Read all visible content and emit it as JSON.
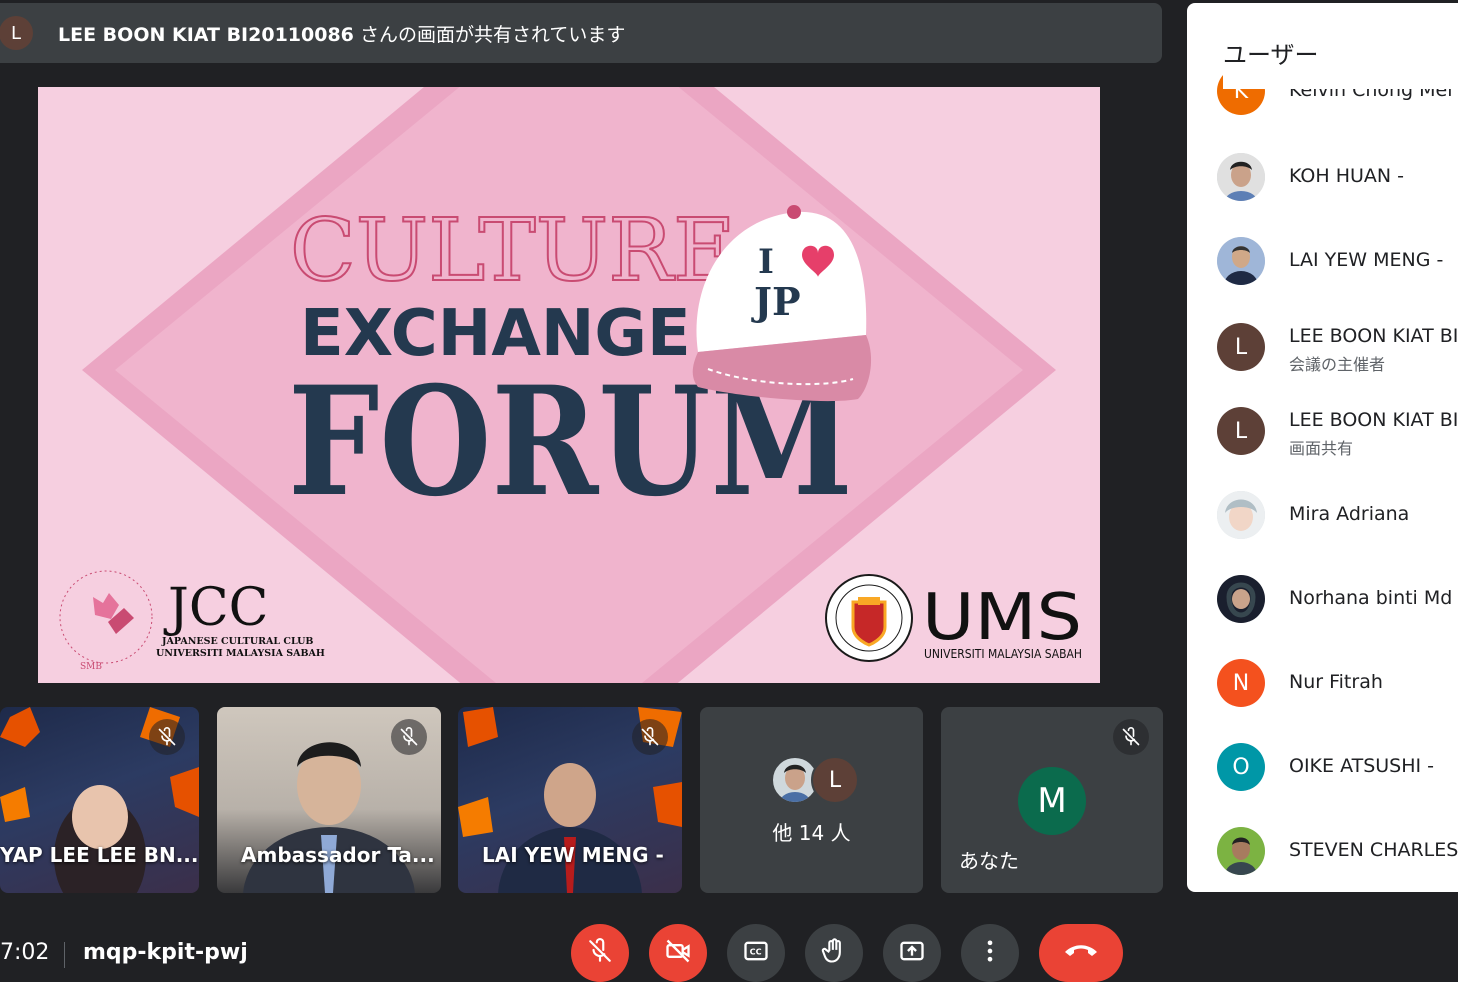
{
  "banner": {
    "avatar_letter": "L",
    "presenter": "LEE BOON KIAT BI20110086",
    "suffix": " さんの画面が共有されています"
  },
  "slide": {
    "line1": "CULTURE",
    "line2": "EXCHANGE",
    "line3": "FORUM",
    "cap_line1": "I",
    "cap_line2": "JP",
    "left_logo_title": "JCC",
    "left_logo_sub1": "JAPANESE CULTURAL CLUB",
    "left_logo_sub2": "UNIVERSITI MALAYSIA SABAH",
    "seal_text": "JAPANESE CULTURAL CLUB",
    "seal_bottom": "SMB",
    "right_logo_title": "UMS",
    "right_logo_sub": "UNIVERSITI MALAYSIA SABAH",
    "ums_seal_text": "UNIVERSITI MALAYSIA",
    "ums_seal_bottom": "SABAH",
    "colors": {
      "pink_bg": "#f3c1d6",
      "diamond": "#eba6c3",
      "navy": "#24394f",
      "rose": "#c94b72"
    }
  },
  "tiles": [
    {
      "name": "YAP LEE LEE BN..."
    },
    {
      "name": "Ambassador Ta..."
    },
    {
      "name": "LAI YEW MENG -"
    },
    {
      "others": "他 14 人",
      "badge": "L"
    },
    {
      "name": "あなた",
      "letter": "M"
    }
  ],
  "bottom": {
    "time": "7:02",
    "meeting_code": "mqp-kpit-pwj"
  },
  "panel": {
    "title": "ユーザー",
    "people": [
      {
        "name": "Kelvin Chong Mei",
        "letter": "K",
        "color": "#ef6c00"
      },
      {
        "name": "KOH HUAN -",
        "photo": true
      },
      {
        "name": "LAI YEW MENG -",
        "photo": true
      },
      {
        "name": "LEE BOON KIAT BI",
        "sub": "会議の主催者",
        "letter": "L",
        "color": "#5d4037"
      },
      {
        "name": "LEE BOON KIAT BI",
        "sub": "画面共有",
        "letter": "L",
        "color": "#5d4037"
      },
      {
        "name": "Mira Adriana",
        "photo": true
      },
      {
        "name": "Norhana binti Md S",
        "photo": true
      },
      {
        "name": "Nur Fitrah",
        "letter": "N",
        "color": "#f4511e"
      },
      {
        "name": "OIKE ATSUSHI -",
        "letter": "O",
        "color": "#0097a7"
      },
      {
        "name": "STEVEN CHARLES",
        "photo": true
      }
    ]
  }
}
